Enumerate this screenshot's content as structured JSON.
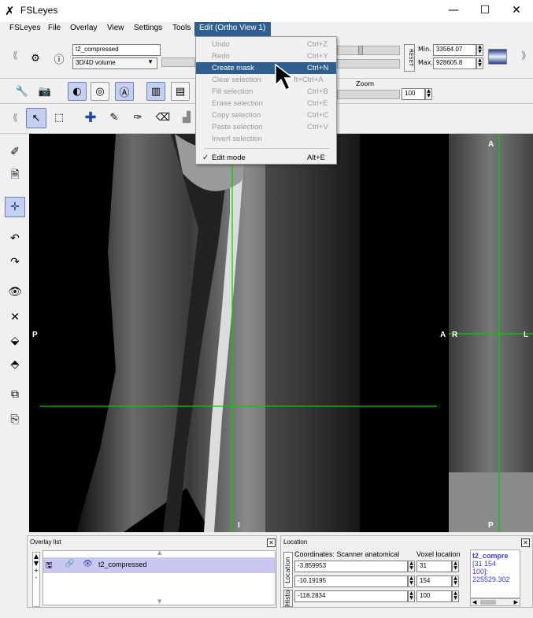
{
  "window": {
    "title": "FSLeyes",
    "minimize": "—",
    "maximize": "☐",
    "close": "✕"
  },
  "menubar": [
    "FSLeyes",
    "File",
    "Overlay",
    "View",
    "Settings",
    "Tools"
  ],
  "active_menu": "Edit (Ortho View 1)",
  "overlay_toolbar": {
    "overlay_name": "t2_compressed",
    "overlay_type": "3D/4D volume",
    "reset_label": "RESET",
    "min_label": "Min.",
    "min_value": "33564.07",
    "max_label": "Max.",
    "max_value": "928605.8"
  },
  "ortho_toolbar": {
    "zoom_label": "Zoom",
    "zoom_value": "100"
  },
  "edit_menu": {
    "items": [
      {
        "label": "Undo",
        "shortcut": "Ctrl+Z",
        "enabled": false
      },
      {
        "label": "Redo",
        "shortcut": "Ctrl+Y",
        "enabled": false
      },
      {
        "label": "Create mask",
        "shortcut": "Ctrl+N",
        "enabled": true,
        "highlighted": true
      },
      {
        "label": "Clear selection",
        "shortcut": "ft+Ctrl+A",
        "enabled": false
      },
      {
        "label": "Fill selection",
        "shortcut": "Ctrl+B",
        "enabled": false
      },
      {
        "label": "Erase selection",
        "shortcut": "Ctrl+E",
        "enabled": false
      },
      {
        "label": "Copy selection",
        "shortcut": "Ctrl+C",
        "enabled": false
      },
      {
        "label": "Paste selection",
        "shortcut": "Ctrl+V",
        "enabled": false
      },
      {
        "label": "Invert selection",
        "shortcut": "",
        "enabled": false
      }
    ],
    "check_item": {
      "check": "✓",
      "label": "Edit mode",
      "shortcut": "Alt+E"
    }
  },
  "viewer": {
    "sagittal_labels": {
      "posterior": "P",
      "anterior": "A",
      "inferior": "I"
    },
    "coronal_labels": {
      "top": "A",
      "right_side": "R",
      "left_side": "L",
      "bottom": "P",
      "left_edge": "A"
    }
  },
  "overlay_list": {
    "title": "Overlay list",
    "items": [
      {
        "name": "t2_compressed"
      }
    ],
    "buttons": {
      "up": "▲",
      "down": "▼",
      "add": "+",
      "remove": "-"
    }
  },
  "location_panel": {
    "title": "Location",
    "coords_label": "Coordinates: Scanner anatomical",
    "voxel_label": "Voxel location",
    "tab_location": "Location",
    "tab_history": "History",
    "coords": [
      "-3.859953",
      "-10.19195",
      "-118.2834"
    ],
    "voxels": [
      "31",
      "154",
      "100"
    ],
    "info_name": "t2_compre",
    "info_voxel": "[31 154",
    "info_voxel2": "100]:",
    "info_value": "225529.302"
  },
  "colors": {
    "menu_highlight": "#2f5f8f",
    "crosshair": "#00d000",
    "selected_overlay": "#c8c8f0",
    "info_text": "#3a3acc"
  }
}
